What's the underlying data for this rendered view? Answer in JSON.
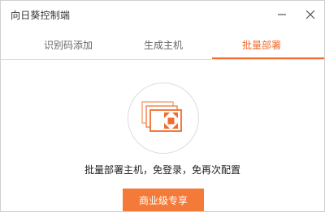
{
  "window": {
    "title": "向日葵控制端"
  },
  "titlebar": {
    "minimize_icon": "minimize-icon",
    "close_icon": "close-icon"
  },
  "tabs": [
    {
      "label": "识别码添加",
      "active": false
    },
    {
      "label": "生成主机",
      "active": false
    },
    {
      "label": "批量部署",
      "active": true
    }
  ],
  "main": {
    "illustration_icon": "batch-deploy-icon",
    "description": "批量部署主机，免登录，免再次配置",
    "cta_label": "商业级专享"
  },
  "colors": {
    "accent": "#f26b2b",
    "button": "#f47a3a",
    "text": "#222222",
    "muted_text": "#666666"
  }
}
